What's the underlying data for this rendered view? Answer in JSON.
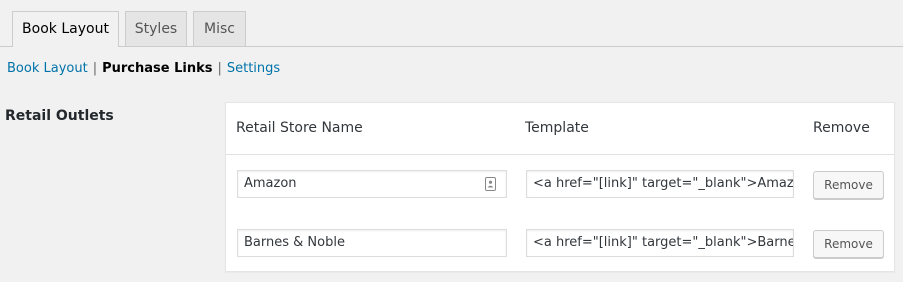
{
  "tabs": [
    {
      "label": "Book Layout",
      "active": true
    },
    {
      "label": "Styles",
      "active": false
    },
    {
      "label": "Misc",
      "active": false
    }
  ],
  "subnav": {
    "items": [
      {
        "label": "Book Layout",
        "current": false
      },
      {
        "label": "Purchase Links",
        "current": true
      },
      {
        "label": "Settings",
        "current": false
      }
    ],
    "separator": "|"
  },
  "section": {
    "label": "Retail Outlets"
  },
  "table": {
    "headers": {
      "name": "Retail Store Name",
      "template": "Template",
      "remove": "Remove"
    },
    "rows": [
      {
        "name": "Amazon",
        "template": "<a href=\"[link]\" target=\"_blank\">Amazon</a>",
        "remove_label": "Remove"
      },
      {
        "name": "Barnes & Noble",
        "template": "<a href=\"[link]\" target=\"_blank\">Barnes & Noble</a>",
        "remove_label": "Remove"
      }
    ]
  },
  "colors": {
    "link": "#0073aa",
    "background": "#f1f1f1",
    "card": "#ffffff"
  },
  "icons": {
    "autofill": "contact-card-icon"
  }
}
